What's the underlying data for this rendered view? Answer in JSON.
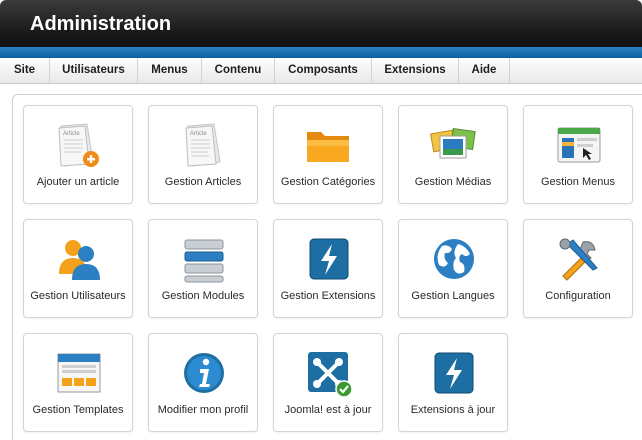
{
  "header": {
    "title": "Administration"
  },
  "menu": [
    {
      "label": "Site"
    },
    {
      "label": "Utilisateurs"
    },
    {
      "label": "Menus"
    },
    {
      "label": "Contenu"
    },
    {
      "label": "Composants"
    },
    {
      "label": "Extensions"
    },
    {
      "label": "Aide"
    }
  ],
  "tiles": [
    {
      "label": "Ajouter un article",
      "icon": "add-article-icon"
    },
    {
      "label": "Gestion Articles",
      "icon": "articles-icon"
    },
    {
      "label": "Gestion Catégories",
      "icon": "folder-icon"
    },
    {
      "label": "Gestion Médias",
      "icon": "media-icon"
    },
    {
      "label": "Gestion Menus",
      "icon": "menu-window-icon"
    },
    {
      "label": "Gestion Utilisateurs",
      "icon": "users-icon"
    },
    {
      "label": "Gestion Modules",
      "icon": "modules-icon"
    },
    {
      "label": "Gestion Extensions",
      "icon": "lightning-icon"
    },
    {
      "label": "Gestion Langues",
      "icon": "globe-icon"
    },
    {
      "label": "Configuration",
      "icon": "tools-icon"
    },
    {
      "label": "Gestion Templates",
      "icon": "template-icon"
    },
    {
      "label": "Modifier mon profil",
      "icon": "info-icon"
    },
    {
      "label": "Joomla! est à jour",
      "icon": "joomla-check-icon"
    },
    {
      "label": "Extensions à jour",
      "icon": "lightning-icon"
    }
  ],
  "colors": {
    "header_dark": "#1a1a1a",
    "stripe_blue": "#1670b5",
    "folder_orange": "#f7a21b",
    "lightning_blue": "#1d6fa3"
  }
}
